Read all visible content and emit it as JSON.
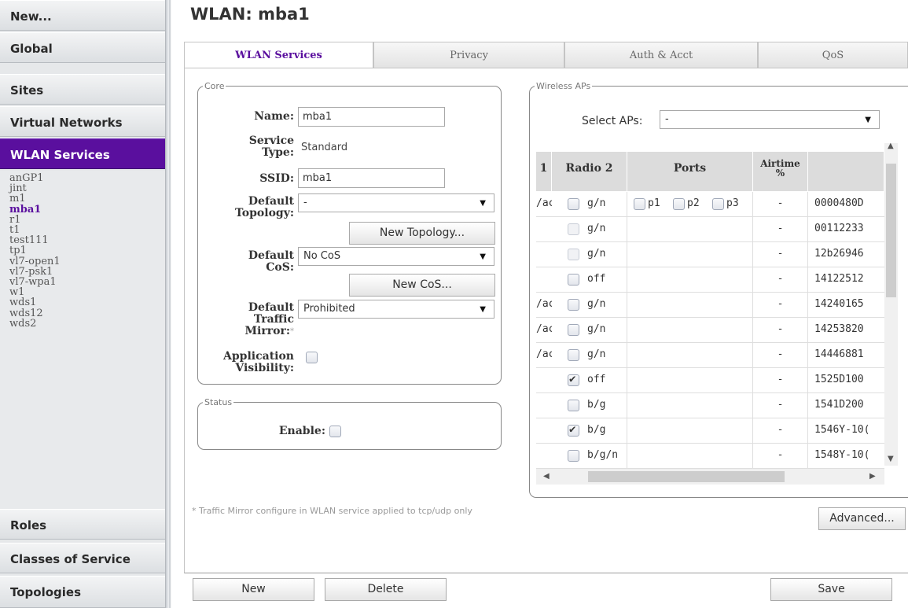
{
  "nav": {
    "buttons": {
      "new": "New...",
      "global": "Global",
      "sites": "Sites",
      "virtual_networks": "Virtual Networks",
      "wlan_services": "WLAN Services",
      "roles": "Roles",
      "classes_of_service": "Classes of Service",
      "topologies": "Topologies"
    },
    "wlan_list": [
      "anGP1",
      "jint",
      "m1",
      "mba1",
      "r1",
      "t1",
      "test111",
      "tp1",
      "vl7-open1",
      "vl7-psk1",
      "vl7-wpa1",
      "w1",
      "wds1",
      "wds12",
      "wds2"
    ],
    "selected_wlan": "mba1"
  },
  "page": {
    "title": "WLAN: mba1"
  },
  "tabs": [
    "WLAN Services",
    "Privacy",
    "Auth & Acct",
    "QoS"
  ],
  "core": {
    "legend": "Core",
    "name_label": "Name:",
    "name_value": "mba1",
    "service_type_label_1": "Service",
    "service_type_label_2": "Type:",
    "service_type_value": "Standard",
    "ssid_label": "SSID:",
    "ssid_value": "mba1",
    "topology_label_1": "Default",
    "topology_label_2": "Topology:",
    "topology_value": "-",
    "new_topology_button": "New Topology...",
    "cos_label_1": "Default",
    "cos_label_2": "CoS:",
    "cos_value": "No CoS",
    "new_cos_button": "New CoS...",
    "traffic_mirror_label_1": "Default",
    "traffic_mirror_label_2": "Traffic",
    "traffic_mirror_label_3": "Mirror:",
    "traffic_mirror_asterisk": "*",
    "traffic_mirror_value": "Prohibited",
    "app_visibility_label_1": "Application",
    "app_visibility_label_2": "Visibility:",
    "app_visibility_checked": false
  },
  "status": {
    "legend": "Status",
    "enable_label": "Enable:",
    "enable_checked": false
  },
  "wireless_aps": {
    "legend": "Wireless APs",
    "select_aps_label": "Select APs:",
    "select_aps_value": "-",
    "columns": {
      "radio1_partial": "1",
      "radio2": "Radio 2",
      "ports": "Ports",
      "airtime_1": "Airtime",
      "airtime_2": "%",
      "serial": ""
    },
    "rows": [
      {
        "r1": "/ac",
        "r2_checked": false,
        "r2_disabled": false,
        "r2_mode": "g/n",
        "ports": [
          "p1",
          "p2",
          "p3"
        ],
        "airtime": "-",
        "serial": "0000480D"
      },
      {
        "r1": "",
        "r2_checked": false,
        "r2_disabled": true,
        "r2_mode": "g/n",
        "ports": [],
        "airtime": "-",
        "serial": "00112233"
      },
      {
        "r1": "",
        "r2_checked": false,
        "r2_disabled": true,
        "r2_mode": "g/n",
        "ports": [],
        "airtime": "-",
        "serial": "12b26946"
      },
      {
        "r1": "",
        "r2_checked": false,
        "r2_disabled": false,
        "r2_mode": "off",
        "ports": [],
        "airtime": "-",
        "serial": "14122512"
      },
      {
        "r1": "/ac",
        "r2_checked": false,
        "r2_disabled": false,
        "r2_mode": "g/n",
        "ports": [],
        "airtime": "-",
        "serial": "14240165"
      },
      {
        "r1": "/ac",
        "r2_checked": false,
        "r2_disabled": false,
        "r2_mode": "g/n",
        "ports": [],
        "airtime": "-",
        "serial": "14253820"
      },
      {
        "r1": "/ac",
        "r2_checked": false,
        "r2_disabled": false,
        "r2_mode": "g/n",
        "ports": [],
        "airtime": "-",
        "serial": "14446881"
      },
      {
        "r1": "",
        "r2_checked": true,
        "r2_disabled": false,
        "r2_mode": "off",
        "ports": [],
        "airtime": "-",
        "serial": "1525D100"
      },
      {
        "r1": "",
        "r2_checked": false,
        "r2_disabled": false,
        "r2_mode": "b/g",
        "ports": [],
        "airtime": "-",
        "serial": "1541D200"
      },
      {
        "r1": "",
        "r2_checked": true,
        "r2_disabled": false,
        "r2_mode": "b/g",
        "ports": [],
        "airtime": "-",
        "serial": "1546Y-10("
      },
      {
        "r1": "",
        "r2_checked": false,
        "r2_disabled": false,
        "r2_mode": "b/g/n",
        "ports": [],
        "airtime": "-",
        "serial": "1548Y-10("
      }
    ]
  },
  "footnote": "* Traffic Mirror configure in WLAN service applied to tcp/udp only",
  "buttons": {
    "advanced": "Advanced...",
    "new": "New",
    "delete": "Delete",
    "save": "Save"
  },
  "icons": {
    "dropdown": "chevron-down-icon",
    "checkmark": "check-icon",
    "scroll_up": "arrow-up-icon",
    "scroll_down": "arrow-down-icon",
    "scroll_left": "arrow-left-icon",
    "scroll_right": "arrow-right-icon"
  },
  "colors": {
    "accent": "#5a0f9e",
    "nav_background": "#e6e8ea",
    "table_header": "#dcdcdc"
  }
}
